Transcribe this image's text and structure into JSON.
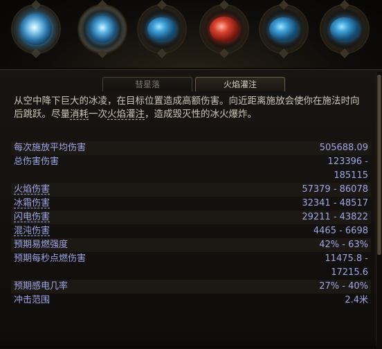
{
  "gems": [
    {
      "name": "orb-gem-icon",
      "style": "orb",
      "active": false
    },
    {
      "name": "frost-orb-gem-icon",
      "style": "orb2",
      "active": true
    },
    {
      "name": "blue-gem-icon-1",
      "style": "blue",
      "active": false
    },
    {
      "name": "red-gem-icon",
      "style": "red",
      "active": false
    },
    {
      "name": "blue-gem-icon-2",
      "style": "blue",
      "active": false
    },
    {
      "name": "blue-gem-icon-3",
      "style": "blue",
      "active": false
    }
  ],
  "tabs": [
    {
      "label": "彗星落",
      "active": false
    },
    {
      "label": "火焰灌注",
      "active": true
    }
  ],
  "description": {
    "part1": "从空中降下巨大的冰凌，在目标位置造成高额伤害。向近距离施放会使你在施法时向后跳跃。尽量",
    "kw1": "消耗",
    "part2": "一次",
    "kw2": "火焰灌注",
    "part3": "，造成毁灭性的冰火爆炸。"
  },
  "stats": [
    {
      "label": "每次施放平均伤害",
      "value": "505688.09",
      "underline": false
    },
    {
      "label": "总伤害伤害",
      "value": "123396 - 185115",
      "underline": false,
      "multi": true
    },
    {
      "label": "火焰伤害",
      "value": "57379 - 86078",
      "underline": true
    },
    {
      "label": "冰霜伤害",
      "value": "32341 - 48517",
      "underline": true
    },
    {
      "label": "闪电伤害",
      "value": "29211 - 43822",
      "underline": true
    },
    {
      "label": "混沌伤害",
      "value": "4465 - 6698",
      "underline": true
    },
    {
      "label": "预期易燃强度",
      "value": "42% - 63%",
      "underline": false
    },
    {
      "label": "预期每秒点燃伤害",
      "value": "11475.8 - 17215.6",
      "underline": false,
      "multi": true
    },
    {
      "label": "预期感电几率",
      "value": "27% - 40%",
      "underline": false
    },
    {
      "label": "冲击范围",
      "value": "2.4米",
      "underline": false
    }
  ],
  "colors": {
    "stat_text": "#9fa6e8",
    "desc_text": "#cfc6b6",
    "panel_bg": "#171411"
  }
}
